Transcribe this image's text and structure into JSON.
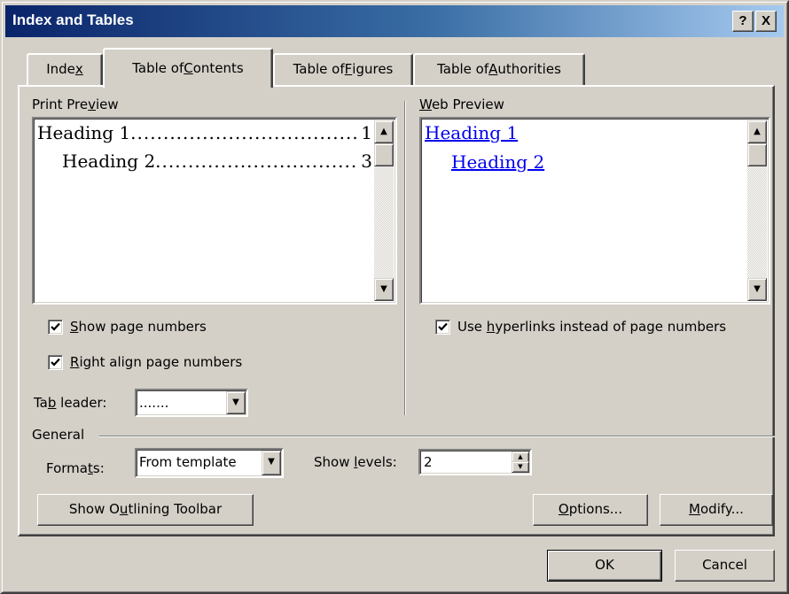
{
  "window": {
    "title": "Index and Tables",
    "help_glyph": "?",
    "close_glyph": "X"
  },
  "tabs": [
    {
      "pre": "Inde",
      "key": "x",
      "post": ""
    },
    {
      "pre": "Table of ",
      "key": "C",
      "post": "ontents",
      "selected": true
    },
    {
      "pre": "Table of ",
      "key": "F",
      "post": "igures"
    },
    {
      "pre": "Table of ",
      "key": "A",
      "post": "uthorities"
    }
  ],
  "print_preview": {
    "label_pre": "Print Pre",
    "label_key": "v",
    "label_post": "iew",
    "entries": [
      {
        "text": "Heading 1",
        "page": "1"
      },
      {
        "text": "Heading 2",
        "page": "3"
      }
    ]
  },
  "web_preview": {
    "label_pre": "",
    "label_key": "W",
    "label_post": "eb Preview",
    "links": [
      "Heading 1",
      "Heading 2"
    ]
  },
  "options": {
    "show_page_numbers": {
      "key": "S",
      "rest": "how page numbers",
      "checked": true
    },
    "right_align": {
      "key": "R",
      "rest": "ight align page numbers",
      "checked": true
    },
    "use_hyperlinks": {
      "pre": "Use ",
      "key": "h",
      "rest": "yperlinks instead of page numbers",
      "checked": true
    },
    "tab_leader": {
      "label_pre": "Ta",
      "label_key": "b",
      "label_post": " leader:",
      "value": "......."
    }
  },
  "general": {
    "heading": "General",
    "formats": {
      "label_pre": "Forma",
      "label_key": "t",
      "label_post": "s:",
      "value": "From template"
    },
    "show_levels": {
      "label_pre": "Show ",
      "label_key": "l",
      "label_post": "evels:",
      "value": "2"
    }
  },
  "buttons": {
    "outlining": {
      "pre": "Show O",
      "key": "u",
      "post": "tlining Toolbar"
    },
    "options": {
      "pre": "",
      "key": "O",
      "post": "ptions..."
    },
    "modify": {
      "pre": "",
      "key": "M",
      "post": "odify..."
    },
    "ok": "OK",
    "cancel": "Cancel"
  },
  "icons": {
    "arrow_up": "▲",
    "arrow_down": "▼"
  },
  "colors": {
    "dialog_face": "#d4d0c8",
    "title_start": "#0a246a",
    "title_end": "#a6caf0",
    "hyperlink": "#0000ee"
  }
}
